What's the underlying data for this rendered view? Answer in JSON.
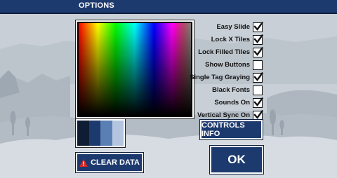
{
  "window": {
    "title": "OPTIONS"
  },
  "colors": {
    "bar": "#1d3a6e",
    "swatch1": "#0e1d33",
    "swatch2": "#1d3a6e",
    "swatch3": "#5a7fb5",
    "swatch4": "#b4c6df"
  },
  "options": [
    {
      "label": "Easy Slide",
      "checked": true
    },
    {
      "label": "Lock X Tiles",
      "checked": true
    },
    {
      "label": "Lock Filled Tiles",
      "checked": true
    },
    {
      "label": "Show Buttons",
      "checked": false
    },
    {
      "label": "Single Tag Graying",
      "checked": true
    },
    {
      "label": "Black Fonts",
      "checked": false
    },
    {
      "label": "Sounds On",
      "checked": true
    },
    {
      "label": "Vertical Sync On",
      "checked": true
    }
  ],
  "buttons": {
    "controls_info": "CONTROLS INFO",
    "ok": "OK",
    "clear_data": "CLEAR DATA"
  },
  "icons": {
    "clear": "warning-icon",
    "check": "checkmark-icon"
  }
}
